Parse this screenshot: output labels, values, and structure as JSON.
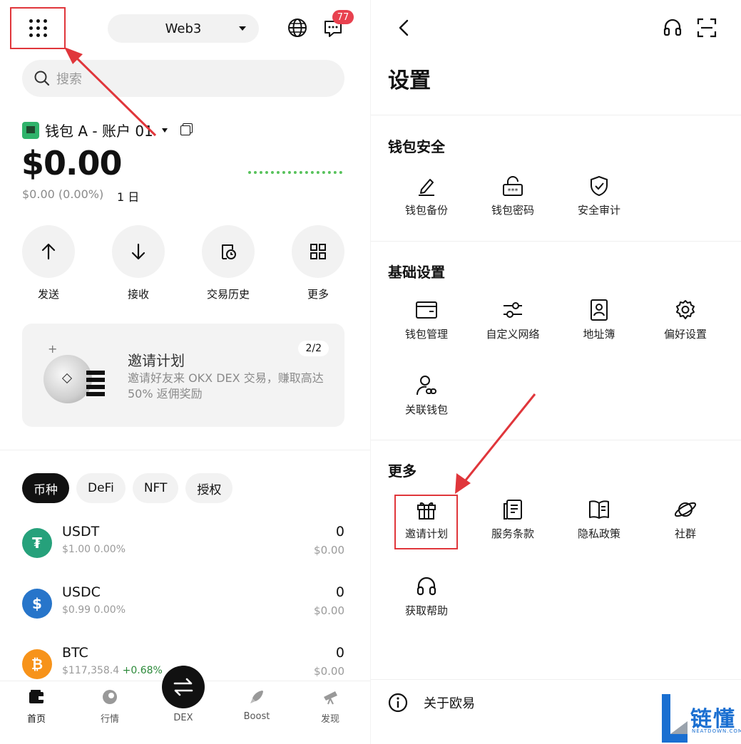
{
  "left": {
    "network": "Web3",
    "notification_count": "77",
    "search_placeholder": "搜索",
    "account_name": "钱包 A - 账户 01",
    "balance": "$0.00",
    "change": "$0.00 (0.00%)",
    "period": "1 日",
    "actions": [
      {
        "label": "发送",
        "icon": "arrow-up-icon"
      },
      {
        "label": "接收",
        "icon": "arrow-down-icon"
      },
      {
        "label": "交易历史",
        "icon": "history-icon"
      },
      {
        "label": "更多",
        "icon": "grid-icon"
      }
    ],
    "promo": {
      "title": "邀请计划",
      "desc": "邀请好友来 OKX DEX 交易，赚取高达 50% 返佣奖励",
      "page": "2/2"
    },
    "tabs": [
      "币种",
      "DeFi",
      "NFT",
      "授权"
    ],
    "tokens": [
      {
        "symbol": "USDT",
        "price": "$1.00",
        "change": "0.00%",
        "amount": "0",
        "fiat": "$0.00",
        "color": "#26a17b",
        "glyph": "₮"
      },
      {
        "symbol": "USDC",
        "price": "$0.99",
        "change": "0.00%",
        "amount": "0",
        "fiat": "$0.00",
        "color": "#2775ca",
        "glyph": "$"
      },
      {
        "symbol": "BTC",
        "price": "$117,358.4",
        "change": "+0.68%",
        "amount": "0",
        "fiat": "$0.00",
        "color": "#f7931a",
        "glyph": "₿"
      }
    ],
    "nav": [
      "首页",
      "行情",
      "DEX",
      "Boost",
      "发现"
    ]
  },
  "right": {
    "title": "设置",
    "sections": [
      {
        "title": "钱包安全",
        "items": [
          {
            "label": "钱包备份",
            "icon": "pen-icon"
          },
          {
            "label": "钱包密码",
            "icon": "lock-icon"
          },
          {
            "label": "安全审计",
            "icon": "shield-check-icon"
          }
        ]
      },
      {
        "title": "基础设置",
        "items": [
          {
            "label": "钱包管理",
            "icon": "wallet-icon"
          },
          {
            "label": "自定义网络",
            "icon": "sliders-icon"
          },
          {
            "label": "地址簿",
            "icon": "contact-book-icon"
          },
          {
            "label": "偏好设置",
            "icon": "gear-icon"
          },
          {
            "label": "关联钱包",
            "icon": "user-link-icon"
          }
        ]
      },
      {
        "title": "更多",
        "items": [
          {
            "label": "邀请计划",
            "icon": "gift-icon"
          },
          {
            "label": "服务条款",
            "icon": "document-icon"
          },
          {
            "label": "隐私政策",
            "icon": "book-icon"
          },
          {
            "label": "社群",
            "icon": "planet-icon"
          },
          {
            "label": "获取帮助",
            "icon": "headset-icon"
          }
        ]
      }
    ],
    "about": "关于欧易"
  },
  "watermark": {
    "text": "链懂",
    "sub": "NEATDOWN.COM"
  },
  "colors": {
    "highlight": "#e0363b",
    "positive": "#2c8a3a",
    "badge": "#e8414f"
  }
}
